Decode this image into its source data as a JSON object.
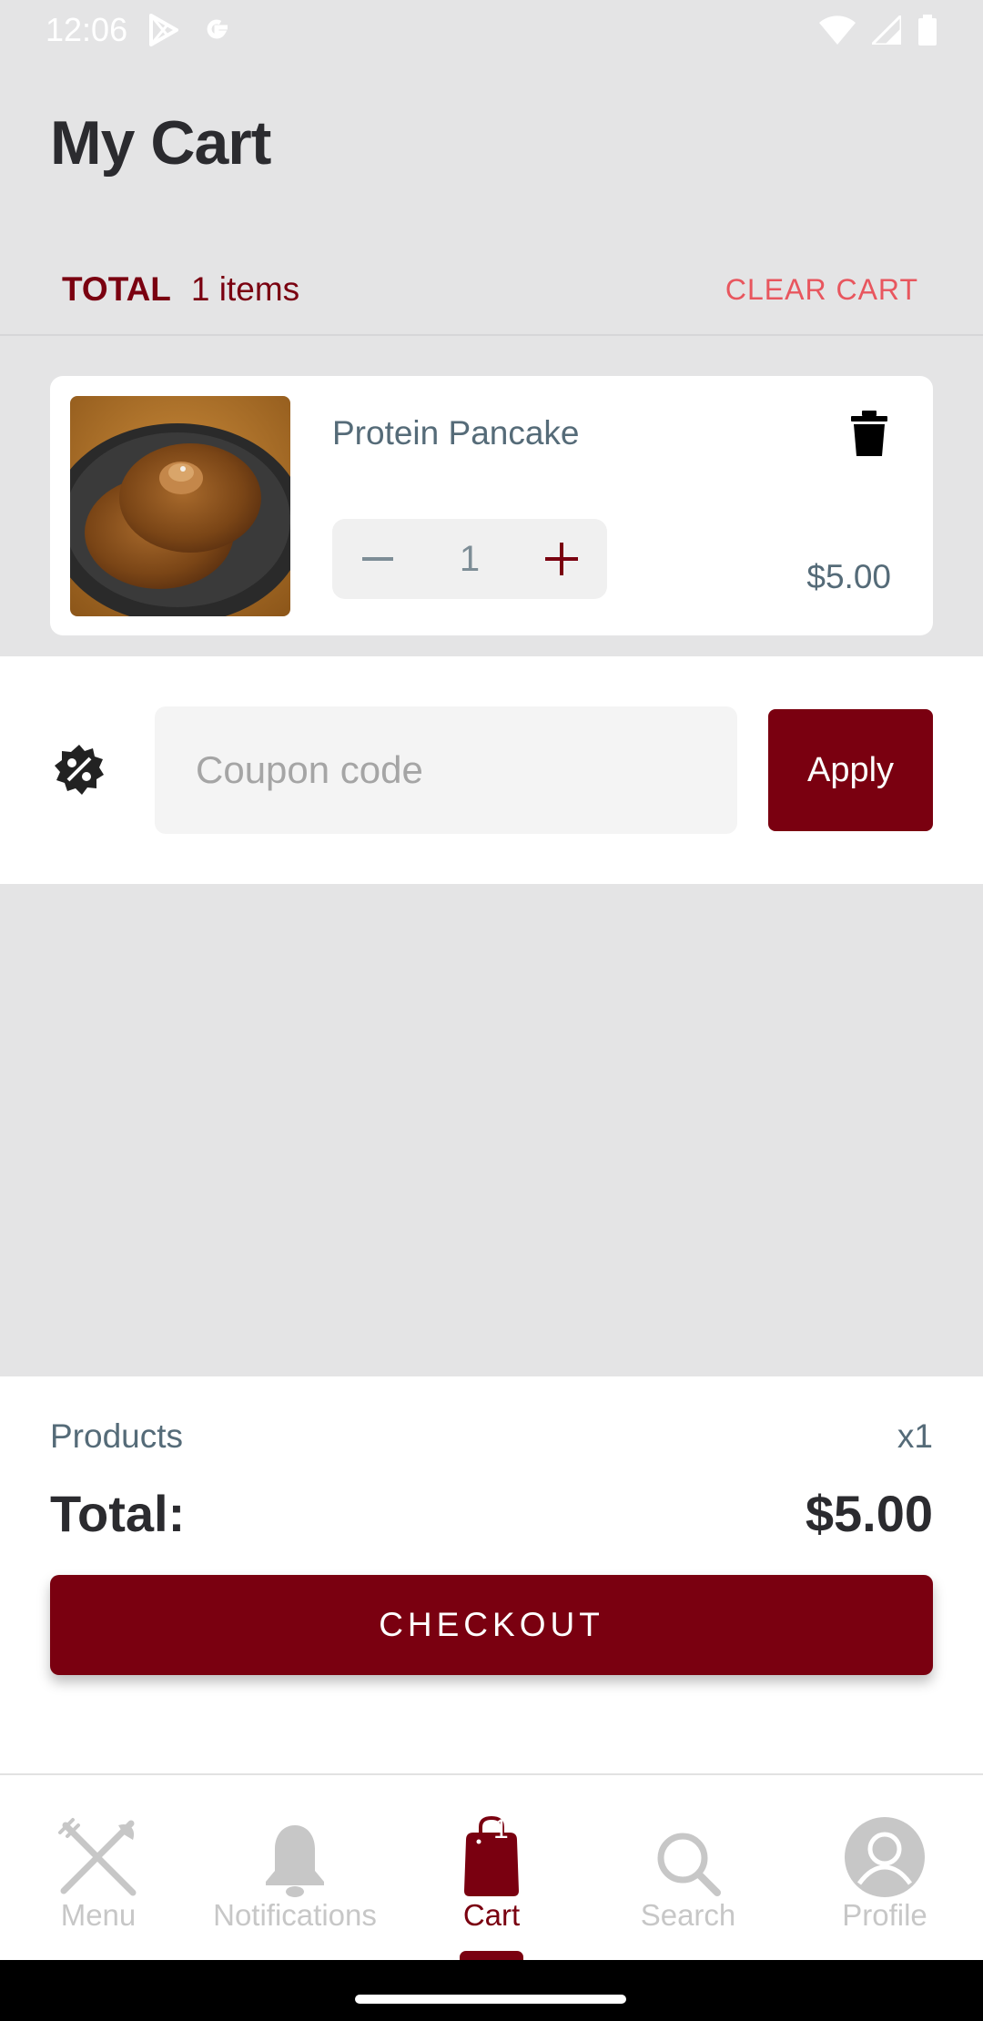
{
  "status_bar": {
    "time": "12:06"
  },
  "header": {
    "title": "My Cart"
  },
  "summary_row": {
    "total_label": "TOTAL",
    "items_count": "1 items",
    "clear_label": "CLEAR CART"
  },
  "cart_items": [
    {
      "name": "Protein Pancake",
      "quantity": "1",
      "price": "$5.00"
    }
  ],
  "coupon": {
    "placeholder": "Coupon code",
    "value": "",
    "apply_label": "Apply"
  },
  "order_summary": {
    "products_label": "Products",
    "products_count": "x1",
    "total_label": "Total:",
    "total_amount": "$5.00",
    "checkout_label": "CHECKOUT"
  },
  "bottom_nav": {
    "items": [
      {
        "label": "Menu",
        "icon": "fork-knife-icon"
      },
      {
        "label": "Notifications",
        "icon": "bell-icon"
      },
      {
        "label": "Cart",
        "icon": "shopping-bag-icon",
        "badge": "1",
        "active": true
      },
      {
        "label": "Search",
        "icon": "search-icon"
      },
      {
        "label": "Profile",
        "icon": "profile-icon"
      }
    ]
  },
  "colors": {
    "brand": "#7a0010",
    "clear_cart": "#e8565e",
    "text_muted": "#556b78",
    "background": "#e4e4e5"
  }
}
